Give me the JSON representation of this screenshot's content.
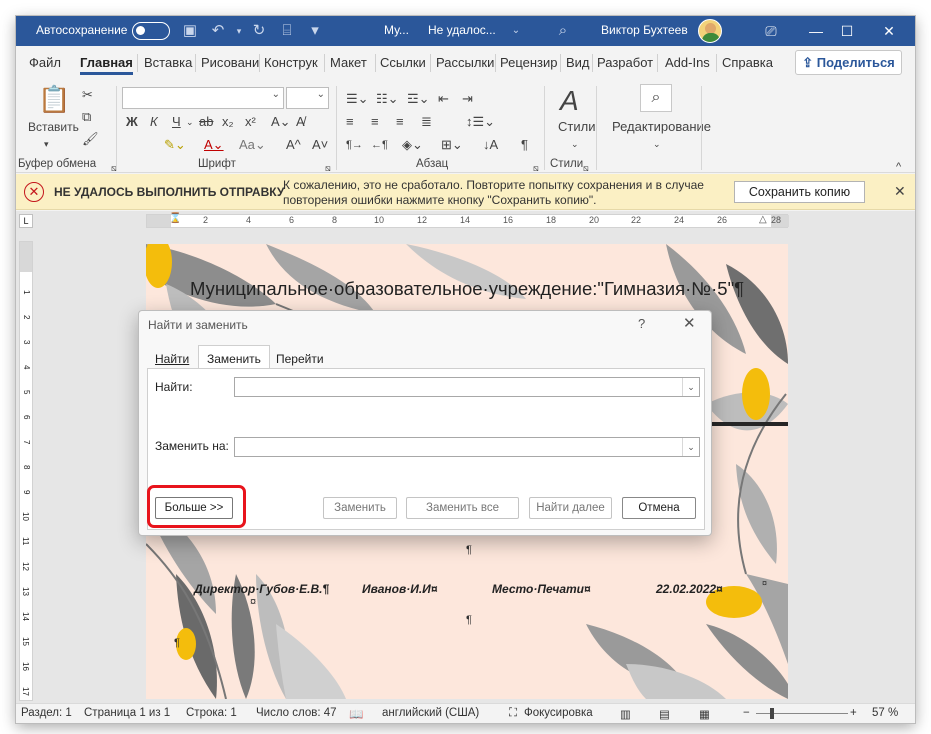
{
  "titlebar": {
    "autosave_label": "Автосохранение",
    "doc_name": "Му...",
    "status": "Не удалос...",
    "user": "Виктор Бухтеев",
    "icons": [
      "save-icon",
      "undo-icon",
      "redo-icon",
      "template-icon",
      "more-icon",
      "search-icon"
    ]
  },
  "tabs": [
    "Файл",
    "Главная",
    "Вставка",
    "Рисовани",
    "Конструк",
    "Макет",
    "Ссылки",
    "Рассылки",
    "Рецензир",
    "Вид",
    "Разработ",
    "Add-Ins",
    "Справка"
  ],
  "share_label": "Поделиться",
  "ribbon": {
    "clipboard": {
      "paste_label": "Вставить",
      "group_label": "Буфер обмена"
    },
    "font": {
      "group_label": "Шрифт",
      "bold": "Ж",
      "italic": "К",
      "underline": "Ч"
    },
    "paragraph": {
      "group_label": "Абзац"
    },
    "styles": {
      "label": "Стили",
      "group_label": "Стили"
    },
    "editing": {
      "label": "Редактирование"
    }
  },
  "message": {
    "title": "НЕ УДАЛОСЬ ВЫПОЛНИТЬ ОТПРАВКУ",
    "text": "К сожалению, это не сработало. Повторите попытку сохранения и в случае повторения ошибки нажмите кнопку \"Сохранить копию\".",
    "button": "Сохранить копию",
    "colors": {
      "background": "#fbf0c4",
      "icon": "#c4161c"
    }
  },
  "ruler_labels": [
    "2",
    "4",
    "6",
    "8",
    "10",
    "12",
    "14",
    "16",
    "18",
    "20",
    "22",
    "24",
    "26",
    "28"
  ],
  "ruler_v_labels": [
    "1",
    "2",
    "3",
    "4",
    "5",
    "6",
    "7",
    "8",
    "9",
    "10",
    "11",
    "12",
    "13",
    "14",
    "15",
    "16",
    "17",
    "18"
  ],
  "document": {
    "title": "Муниципальное·образовательное·учреждение:\"Гимназия·№·5\"¶",
    "sign_director": "Директор·Губов·Е.В.¶",
    "sign_name": "Иванов·И.И¤",
    "sign_place": "Место·Печати¤",
    "sign_date": "22.02.2022¤",
    "pilcrow": "¶",
    "cell_mark": "¤"
  },
  "dialog": {
    "title": "Найти и заменить",
    "help": "?",
    "close": "✕",
    "tabs": [
      "Найти",
      "Заменить",
      "Перейти"
    ],
    "active_tab": "Заменить",
    "find_label": "Найти:",
    "find_value": "",
    "replace_label": "Заменить на:",
    "replace_value": "",
    "buttons": {
      "more": "Больше >>",
      "replace": "Заменить",
      "replace_all": "Заменить все",
      "find_next": "Найти далее",
      "cancel": "Отмена"
    },
    "highlight_color": "#e8141c"
  },
  "status": {
    "section": "Раздел: 1",
    "page": "Страница 1 из 1",
    "line": "Строка: 1",
    "words": "Число слов: 47",
    "language": "английский (США)",
    "focus": "Фокусировка",
    "zoom": "57 %"
  },
  "colors": {
    "accent": "#2b579a"
  }
}
